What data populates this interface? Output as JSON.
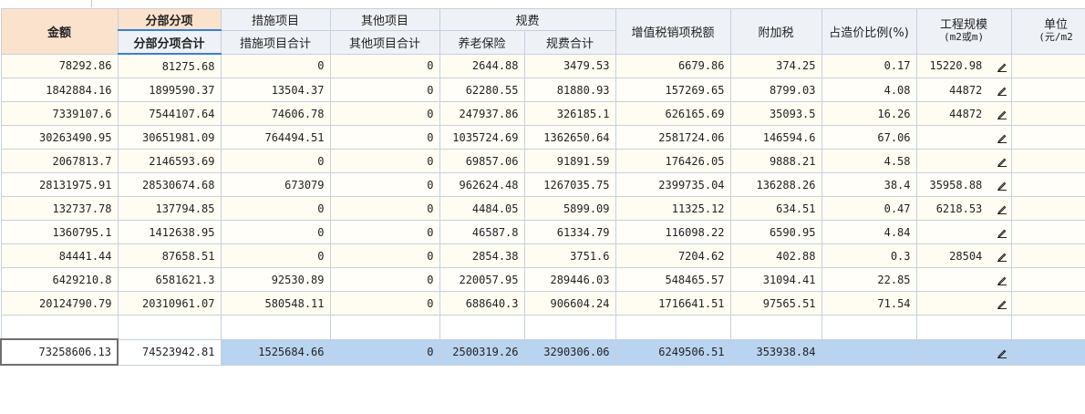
{
  "headers": {
    "amount": "金额",
    "fbfx_group": "分部分项",
    "fbfx_total": "分部分项合计",
    "measures_group": "措施项目",
    "measures_total": "措施项目合计",
    "other_group": "其他项目",
    "other_total": "其他项目合计",
    "fees_group": "规费",
    "pension": "养老保险",
    "fees_total": "规费合计",
    "vat": "增值税销项税额",
    "surtax": "附加税",
    "ratio": "占造价比例(%)",
    "scale_line1": "工程规模",
    "scale_line2": "(m2或m)",
    "unit_line1": "单位",
    "unit_line2": "(元/m2"
  },
  "rows": [
    {
      "amount": "78292.86",
      "fbfx": "81275.68",
      "measures": "0",
      "other": "0",
      "pension": "2644.88",
      "fees": "3479.53",
      "vat": "6679.86",
      "surtax": "374.25",
      "ratio": "0.17",
      "scale": "15220.98"
    },
    {
      "amount": "1842884.16",
      "fbfx": "1899590.37",
      "measures": "13504.37",
      "other": "0",
      "pension": "62280.55",
      "fees": "81880.93",
      "vat": "157269.65",
      "surtax": "8799.03",
      "ratio": "4.08",
      "scale": "44872"
    },
    {
      "amount": "7339107.6",
      "fbfx": "7544107.64",
      "measures": "74606.78",
      "other": "0",
      "pension": "247937.86",
      "fees": "326185.1",
      "vat": "626165.69",
      "surtax": "35093.5",
      "ratio": "16.26",
      "scale": "44872"
    },
    {
      "amount": "30263490.95",
      "fbfx": "30651981.09",
      "measures": "764494.51",
      "other": "0",
      "pension": "1035724.69",
      "fees": "1362650.64",
      "vat": "2581724.06",
      "surtax": "146594.6",
      "ratio": "67.06",
      "scale": ""
    },
    {
      "amount": "2067813.7",
      "fbfx": "2146593.69",
      "measures": "0",
      "other": "0",
      "pension": "69857.06",
      "fees": "91891.59",
      "vat": "176426.05",
      "surtax": "9888.21",
      "ratio": "4.58",
      "scale": ""
    },
    {
      "amount": "28131975.91",
      "fbfx": "28530674.68",
      "measures": "673079",
      "other": "0",
      "pension": "962624.48",
      "fees": "1267035.75",
      "vat": "2399735.04",
      "surtax": "136288.26",
      "ratio": "38.4",
      "scale": "35958.88"
    },
    {
      "amount": "132737.78",
      "fbfx": "137794.85",
      "measures": "0",
      "other": "0",
      "pension": "4484.05",
      "fees": "5899.09",
      "vat": "11325.12",
      "surtax": "634.51",
      "ratio": "0.47",
      "scale": "6218.53"
    },
    {
      "amount": "1360795.1",
      "fbfx": "1412638.95",
      "measures": "0",
      "other": "0",
      "pension": "46587.8",
      "fees": "61334.79",
      "vat": "116098.22",
      "surtax": "6590.95",
      "ratio": "4.84",
      "scale": ""
    },
    {
      "amount": "84441.44",
      "fbfx": "87658.51",
      "measures": "0",
      "other": "0",
      "pension": "2854.38",
      "fees": "3751.6",
      "vat": "7204.62",
      "surtax": "402.88",
      "ratio": "0.3",
      "scale": "28504"
    },
    {
      "amount": "6429210.8",
      "fbfx": "6581621.3",
      "measures": "92530.89",
      "other": "0",
      "pension": "220057.95",
      "fees": "289446.03",
      "vat": "548465.57",
      "surtax": "31094.41",
      "ratio": "22.85",
      "scale": ""
    },
    {
      "amount": "20124790.79",
      "fbfx": "20310961.07",
      "measures": "580548.11",
      "other": "0",
      "pension": "688640.3",
      "fees": "906604.24",
      "vat": "1716641.51",
      "surtax": "97565.51",
      "ratio": "71.54",
      "scale": ""
    }
  ],
  "totals": {
    "amount": "73258606.13",
    "fbfx": "74523942.81",
    "measures": "1525684.66",
    "other": "0",
    "pension": "2500319.26",
    "fees": "3290306.06",
    "vat": "6249506.51",
    "surtax": "353938.84",
    "ratio": "",
    "scale": ""
  },
  "icons": {
    "edit": "pencil-icon"
  },
  "colors": {
    "header_accent": "#fbe2cc",
    "total_row": "#b9d4f0",
    "header_bg": "#eef1f6",
    "row_bg": "#fffdf2"
  }
}
